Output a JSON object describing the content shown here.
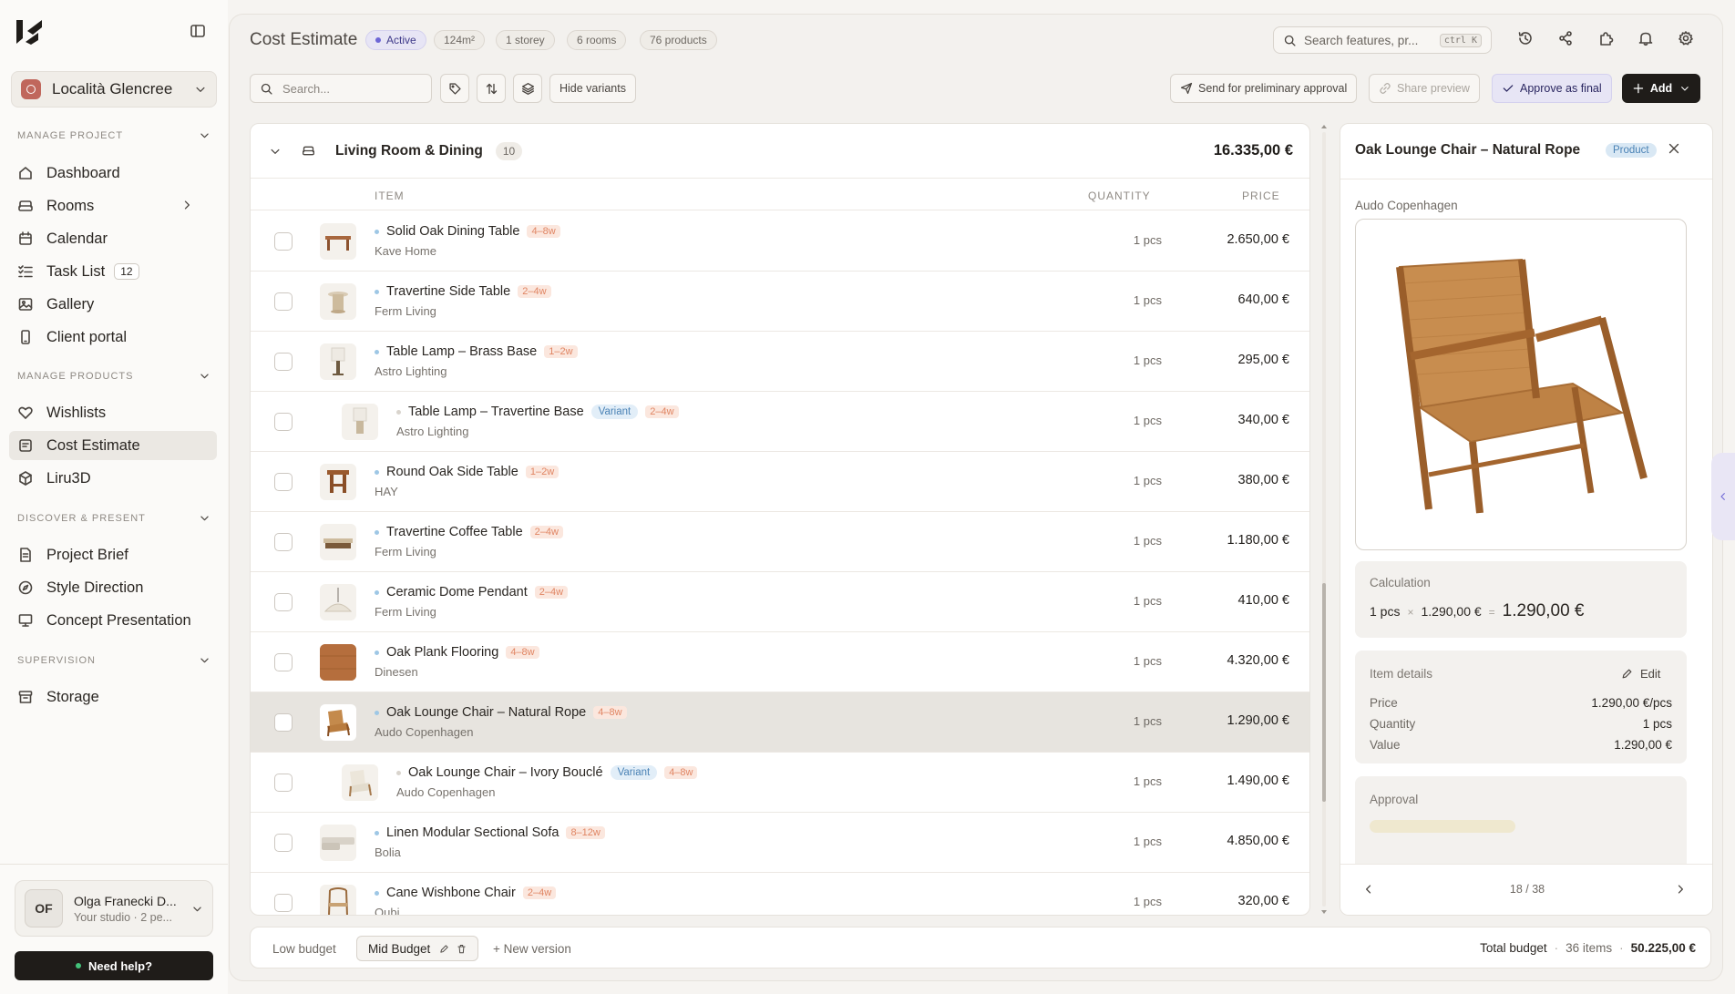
{
  "sidebar": {
    "project_name": "Località Glencree",
    "sections": {
      "manage_project": "MANAGE PROJECT",
      "manage_products": "MANAGE PRODUCTS",
      "discover_present": "DISCOVER & PRESENT",
      "supervision": "SUPERVISION"
    },
    "items": {
      "dashboard": "Dashboard",
      "rooms": "Rooms",
      "calendar": "Calendar",
      "task_list": "Task List",
      "task_count": "12",
      "gallery": "Gallery",
      "client_portal": "Client portal",
      "wishlists": "Wishlists",
      "cost_estimate": "Cost Estimate",
      "liru3d": "Liru3D",
      "project_brief": "Project Brief",
      "style_direction": "Style Direction",
      "concept_presentation": "Concept Presentation",
      "storage": "Storage"
    },
    "user": {
      "initials": "OF",
      "name": "Olga Franecki D...",
      "subtitle": "Your studio · 2 pe..."
    },
    "help_label": "Need help?"
  },
  "header": {
    "title": "Cost Estimate",
    "status": "Active",
    "chips": [
      "124m²",
      "1 storey",
      "6 rooms",
      "76 products"
    ],
    "search_placeholder": "Search features, pr...",
    "search_shortcut": "ctrl K"
  },
  "toolbar": {
    "search_placeholder": "Search...",
    "hide_variants": "Hide variants",
    "send_approval": "Send for preliminary approval",
    "share_preview": "Share preview",
    "approve_final": "Approve as final",
    "add": "Add"
  },
  "group": {
    "title": "Living Room & Dining",
    "count": "10",
    "total": "16.335,00 €"
  },
  "columns": {
    "item": "ITEM",
    "quantity": "QUANTITY",
    "price": "PRICE"
  },
  "rows": [
    {
      "name": "Solid Oak Dining Table",
      "brand": "Kave Home",
      "lead": "4–8w",
      "qty": "1 pcs",
      "price": "2.650,00 €"
    },
    {
      "name": "Travertine Side Table",
      "brand": "Ferm Living",
      "lead": "2–4w",
      "qty": "1 pcs",
      "price": "640,00 €"
    },
    {
      "name": "Table Lamp – Brass Base",
      "brand": "Astro Lighting",
      "lead": "1–2w",
      "qty": "1 pcs",
      "price": "295,00 €"
    },
    {
      "name": "Table Lamp – Travertine Base",
      "brand": "Astro Lighting",
      "lead": "2–4w",
      "variant": "Variant",
      "qty": "1 pcs",
      "price": "340,00 €"
    },
    {
      "name": "Round Oak Side Table",
      "brand": "HAY",
      "lead": "1–2w",
      "qty": "1 pcs",
      "price": "380,00 €"
    },
    {
      "name": "Travertine Coffee Table",
      "brand": "Ferm Living",
      "lead": "2–4w",
      "qty": "1 pcs",
      "price": "1.180,00 €"
    },
    {
      "name": "Ceramic Dome Pendant",
      "brand": "Ferm Living",
      "lead": "2–4w",
      "qty": "1 pcs",
      "price": "410,00 €"
    },
    {
      "name": "Oak Plank Flooring",
      "brand": "Dinesen",
      "lead": "4–8w",
      "qty": "1 pcs",
      "price": "4.320,00 €"
    },
    {
      "name": "Oak Lounge Chair – Natural Rope",
      "brand": "Audo Copenhagen",
      "lead": "4–8w",
      "qty": "1 pcs",
      "price": "1.290,00 €"
    },
    {
      "name": "Oak Lounge Chair – Ivory Bouclé",
      "brand": "Audo Copenhagen",
      "lead": "4–8w",
      "variant": "Variant",
      "qty": "1 pcs",
      "price": "1.490,00 €"
    },
    {
      "name": "Linen Modular Sectional Sofa",
      "brand": "Bolia",
      "lead": "8–12w",
      "qty": "1 pcs",
      "price": "4.850,00 €"
    },
    {
      "name": "Cane Wishbone Chair",
      "brand": "Oubi",
      "lead": "2–4w",
      "qty": "1 pcs",
      "price": "320,00 €"
    }
  ],
  "detail": {
    "title": "Oak Lounge Chair – Natural Rope",
    "type": "Product",
    "brand": "Audo Copenhagen",
    "calculation_label": "Calculation",
    "calc_qty": "1 pcs",
    "calc_unit": "1.290,00 €",
    "calc_total": "1.290,00 €",
    "item_details_label": "Item details",
    "edit_label": "Edit",
    "price_label": "Price",
    "price_value": "1.290,00 €/pcs",
    "quantity_label": "Quantity",
    "quantity_value": "1 pcs",
    "value_label": "Value",
    "value_value": "1.290,00 €",
    "approval_label": "Approval",
    "pager": "18 / 38"
  },
  "footer": {
    "versions": [
      "Low budget",
      "Mid Budget"
    ],
    "new_version": "+ New version",
    "total_label": "Total budget",
    "items_count": "36 items",
    "total_value": "50.225,00 €"
  }
}
